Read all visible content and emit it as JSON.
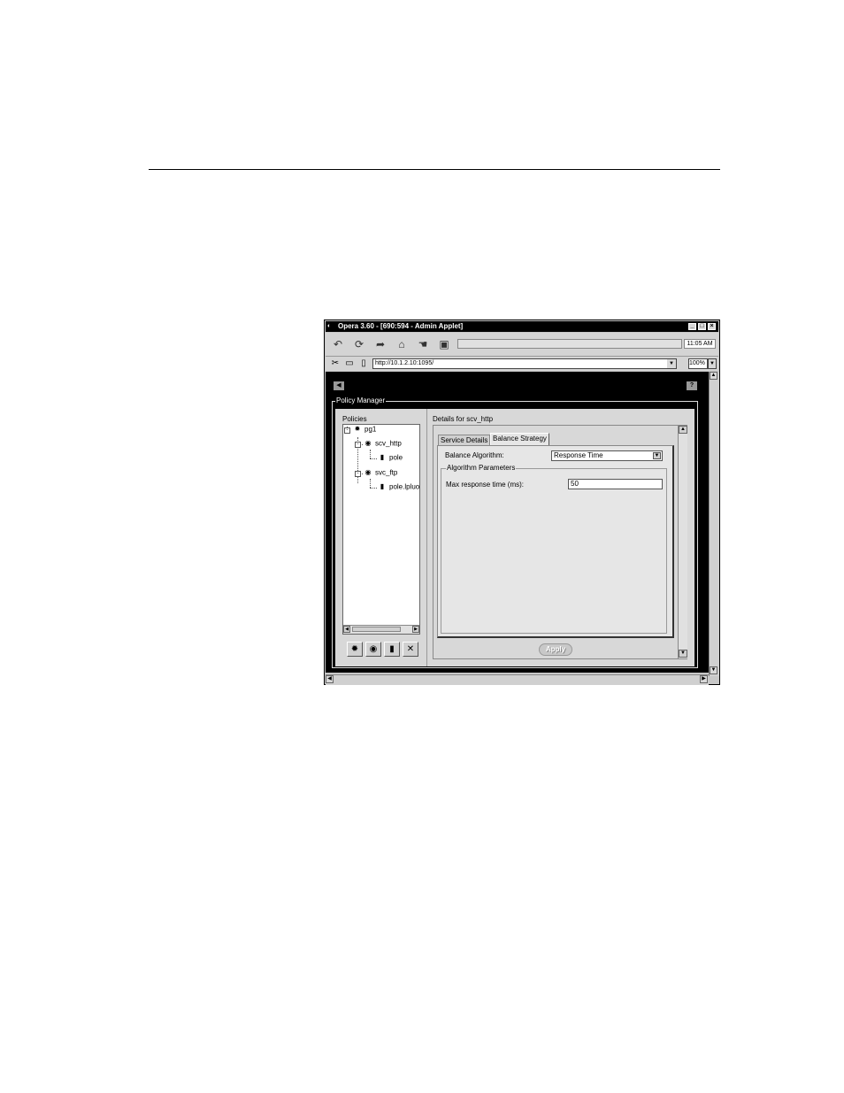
{
  "window": {
    "title": "Opera 3.60 - [690:594 - Admin Applet]",
    "minimize": "_",
    "maximize": "□",
    "close": "×"
  },
  "toolbar": {
    "clock": "11:05 AM"
  },
  "address": {
    "url": "http://10.1.2.10:1095/",
    "zoom": "100%"
  },
  "applet": {
    "back": "◀",
    "help": "?",
    "panel_title": "Policy Manager",
    "policies_label": "Policies",
    "tree": [
      {
        "label": "pg1",
        "level": 0
      },
      {
        "label": "scv_http",
        "level": 1
      },
      {
        "label": "pole",
        "level": 2
      },
      {
        "label": "svc_ftp",
        "level": 1
      },
      {
        "label": "pole.lpluo",
        "level": 2
      }
    ],
    "details_label": "Details for scv_http",
    "tabs": [
      {
        "label": "Service Details",
        "active": false
      },
      {
        "label": "Balance Strategy",
        "active": true
      }
    ],
    "balance_algorithm_label": "Balance Algorithm:",
    "balance_algorithm_value": "Response Time",
    "algorithm_parameters_title": "Algorithm Parameters",
    "max_response_label": "Max response time (ms):",
    "max_response_value": "50",
    "apply_label": "Apply"
  }
}
